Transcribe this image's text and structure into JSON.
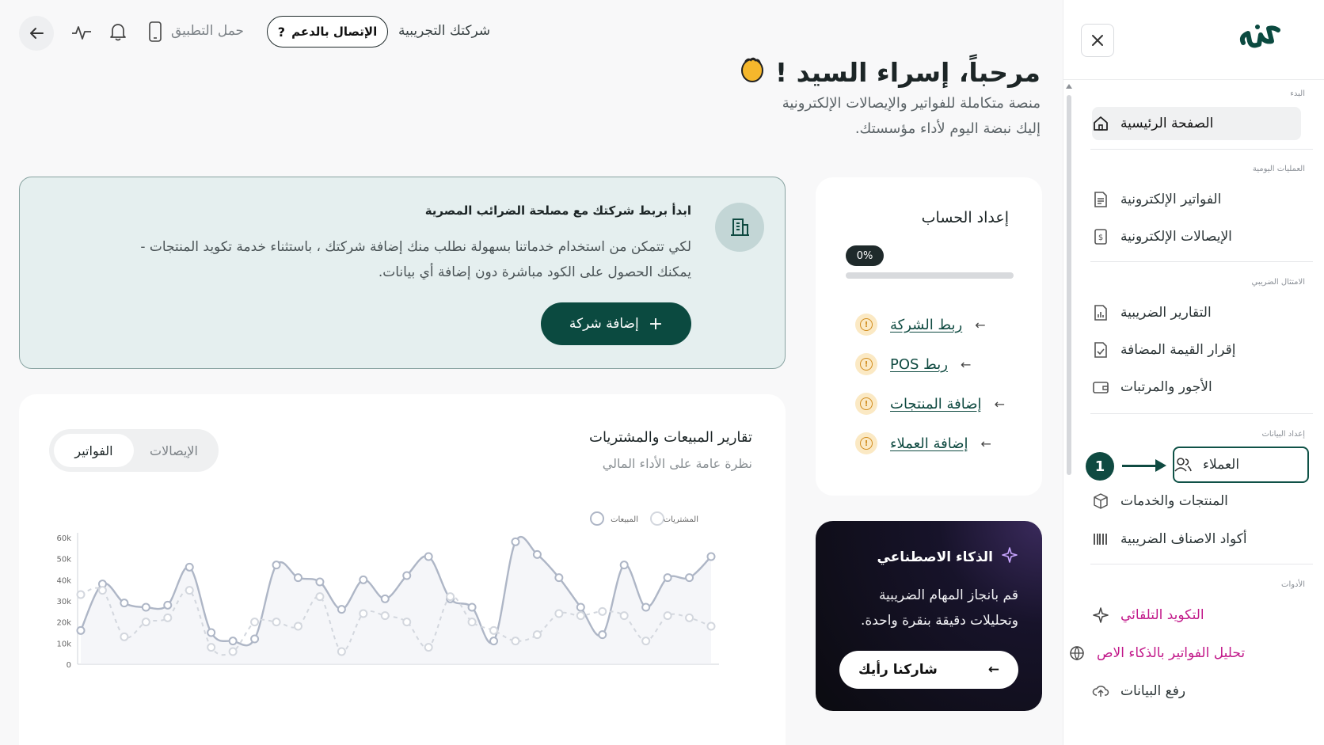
{
  "topbar": {
    "company_name": "شركتك التجريبية",
    "support_label": "الإتصال بالدعم",
    "download_app": "حمل التطبيق"
  },
  "header": {
    "welcome": "مرحباً، إسراء السيد !",
    "subtitle1": "منصة متكاملة للفواتير والإيصالات الإلكترونية",
    "subtitle2": "إليك نبضة اليوم لأداء مؤسستك."
  },
  "sidebar": {
    "sections": [
      {
        "label": "البدء",
        "items": [
          {
            "label": "الصفحة الرئيسية",
            "icon": "home-icon"
          }
        ]
      },
      {
        "label": "العمليات اليومية",
        "items": [
          {
            "label": "الفواتير الإلكترونية",
            "icon": "document-icon"
          },
          {
            "label": "الإيصالات الإلكترونية",
            "icon": "receipt-icon"
          }
        ]
      },
      {
        "label": "الامتثال الضريبي",
        "items": [
          {
            "label": "التقارير الضريبية",
            "icon": "report-icon"
          },
          {
            "label": "إقرار القيمة المضافة",
            "icon": "file-check-icon"
          },
          {
            "label": "الأجور والمرتبات",
            "icon": "wallet-icon"
          }
        ]
      },
      {
        "label": "إعداد البيانات",
        "items": [
          {
            "label": "العملاء",
            "icon": "users-icon"
          },
          {
            "label": "المنتجات والخدمات",
            "icon": "box-icon"
          },
          {
            "label": "أكواد الاصناف الضريبية",
            "icon": "barcode-icon"
          }
        ]
      },
      {
        "label": "الأدوات",
        "items": [
          {
            "label": "التكويد التلقائي",
            "icon": "sparkle-icon"
          },
          {
            "label": "تحليل الفواتير بالذكاء الاص",
            "icon": "globe-icon"
          },
          {
            "label": "رفع البيانات",
            "icon": "upload-cloud-icon"
          }
        ]
      }
    ],
    "callout_number": "1"
  },
  "setup": {
    "title": "إعداد الحساب",
    "progress_label": "0%",
    "progress": 0,
    "tasks": [
      {
        "label": "ربط الشركة"
      },
      {
        "label": "ربط POS"
      },
      {
        "label": "إضافة المنتجات"
      },
      {
        "label": "إضافة العملاء"
      }
    ]
  },
  "ai": {
    "title": "الذكاء الاصطناعي",
    "text1": "قم بانجاز المهام الضريبية",
    "text2": "وتحليلات دقيقة بنقرة واحدة.",
    "button": "شاركنا رأيك"
  },
  "company": {
    "title": "ابدأ بربط شركتك مع مصلحة الضرائب المصرية",
    "text1": "لكي تتمكن من استخدام خدماتنا بسهولة نطلب منك إضافة شركتك ، باستثناء خدمة تكويد المنتجات -",
    "text2": "يمكنك الحصول على الكود مباشرة دون إضافة أي بيانات.",
    "button": "إضافة شركة"
  },
  "reports": {
    "title": "تقارير المبيعات والمشتريات",
    "subtitle": "نظرة عامة على الأداء المالي",
    "tabs": [
      "الفواتير",
      "الإيصالات"
    ],
    "active_tab": 0
  },
  "colors": {
    "brand": "#0b4a40",
    "sales": "#aeb6c6",
    "purchases": "#d3d7de",
    "magenta": "#c2198a"
  },
  "chart_data": {
    "type": "line",
    "legend": [
      "المبيعات",
      "المشتريات"
    ],
    "legend_position": "top-right",
    "y_ticks": [
      "0",
      "10k",
      "20k",
      "30k",
      "40k",
      "50k",
      "60k"
    ],
    "ylim": [
      0,
      60000
    ],
    "grid": false,
    "series": [
      {
        "name": "المبيعات",
        "values": [
          16000,
          38000,
          29000,
          27000,
          28000,
          46000,
          15000,
          11000,
          12000,
          47000,
          41000,
          39000,
          26000,
          40000,
          31000,
          42000,
          51000,
          31000,
          27000,
          11000,
          58000,
          52000,
          41000,
          27000,
          14000,
          47000,
          27000,
          41000,
          41000,
          51000
        ]
      },
      {
        "name": "المشتريات",
        "values": [
          33000,
          35000,
          13000,
          20000,
          22000,
          35000,
          8000,
          6000,
          20000,
          20000,
          18000,
          32000,
          6000,
          24000,
          23000,
          20000,
          8000,
          32000,
          20000,
          16000,
          11000,
          14000,
          24000,
          23000,
          25000,
          23000,
          11000,
          23000,
          22000,
          18000
        ]
      }
    ]
  }
}
